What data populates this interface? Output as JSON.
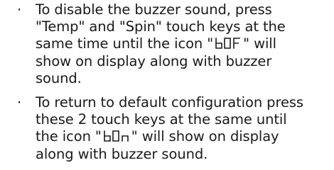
{
  "bullets": [
    {
      "marker": "·",
      "lines": [
        "To disable the buzzer sound, press",
        "\"Temp\" and \"Spin\" touch keys at the",
        "same time until the icon \"",
        "\" will",
        "show on display along with buzzer",
        "sound."
      ],
      "icon_code": "bOF"
    },
    {
      "marker": "·",
      "lines": [
        "To return to default configuration press",
        "these 2 touch keys at the same until",
        "the icon \"",
        "\" will show on display",
        "along with buzzer sound."
      ],
      "icon_code": "bOn"
    }
  ]
}
